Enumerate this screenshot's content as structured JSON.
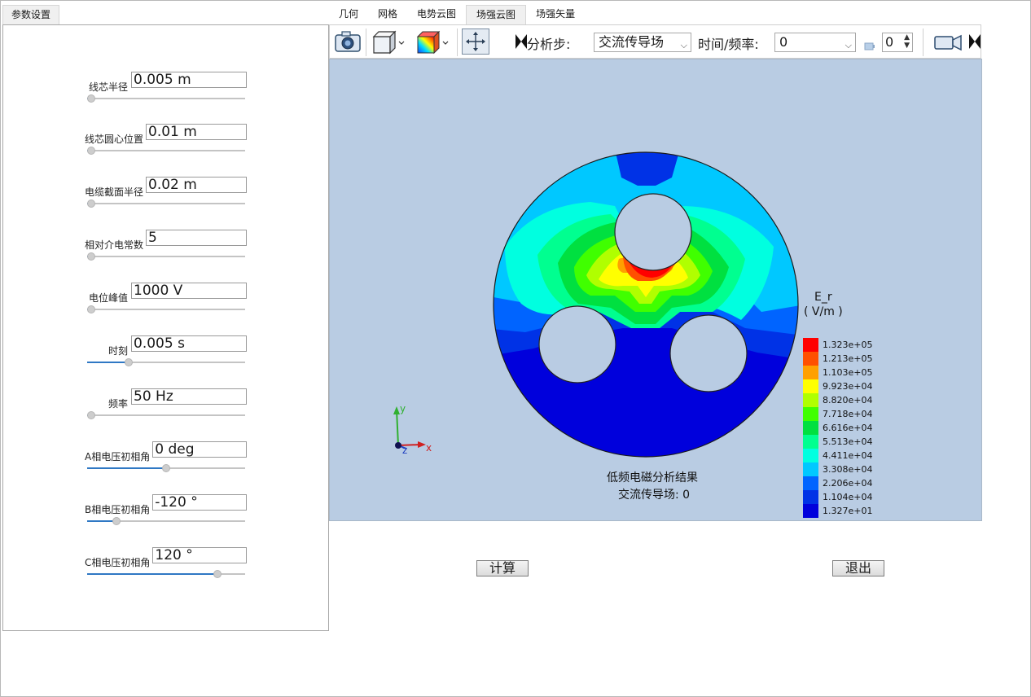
{
  "left_tab": "参数设置",
  "params": [
    {
      "label": "线芯半径",
      "value": "0.005 m",
      "level": 0
    },
    {
      "label": "线芯圆心位置",
      "value": "0.01 m",
      "level": 0
    },
    {
      "label": "电缆截面半径",
      "value": "0.02 m",
      "level": 0
    },
    {
      "label": "相对介电常数",
      "value": "5",
      "level": 0
    },
    {
      "label": "电位峰值",
      "value": "1000 V",
      "level": 0
    },
    {
      "label": "时刻",
      "value": "0.005 s",
      "level": 0.25
    },
    {
      "label": "频率",
      "value": "50 Hz",
      "level": 0
    },
    {
      "label": "A相电压初相角",
      "value": "0 deg",
      "level": 0.5
    },
    {
      "label": "B相电压初相角",
      "value": "-120 °",
      "level": 0.17
    },
    {
      "label": "C相电压初相角",
      "value": "120 °",
      "level": 0.84
    }
  ],
  "tabs": [
    "几何",
    "网格",
    "电势云图",
    "场强云图",
    "场强矢量"
  ],
  "active_tab": "场强云图",
  "toolbar": {
    "step_label": "分析步:",
    "step_value": "交流传导场",
    "time_label": "时间/频率:",
    "time_value": "0",
    "frame_value": "0",
    "icons": [
      "camera-icon",
      "cube-view-icon",
      "contour-icon",
      "fit-view-icon",
      "play-icon",
      "movie-icon"
    ]
  },
  "viewport": {
    "legend_title": "E_r",
    "legend_unit": "( V/m )",
    "legend_values": [
      "1.323e+05",
      "1.213e+05",
      "1.103e+05",
      "9.923e+04",
      "8.820e+04",
      "7.718e+04",
      "6.616e+04",
      "5.513e+04",
      "4.411e+04",
      "3.308e+04",
      "2.206e+04",
      "1.104e+04",
      "1.327e+01"
    ],
    "legend_colors": [
      "#ff0000",
      "#ff5000",
      "#ffa000",
      "#ffff00",
      "#b0ff00",
      "#40ff00",
      "#00e040",
      "#00ff90",
      "#00ffe0",
      "#00c8ff",
      "#0064ff",
      "#0032e6",
      "#0000dc"
    ],
    "caption_line1": "低频电磁分析结果",
    "caption_line2": "交流传导场: 0",
    "axes": {
      "x": "x",
      "y": "y",
      "z": "z"
    },
    "background": "#b9cce3"
  },
  "buttons": {
    "compute": "计算",
    "exit": "退出"
  }
}
